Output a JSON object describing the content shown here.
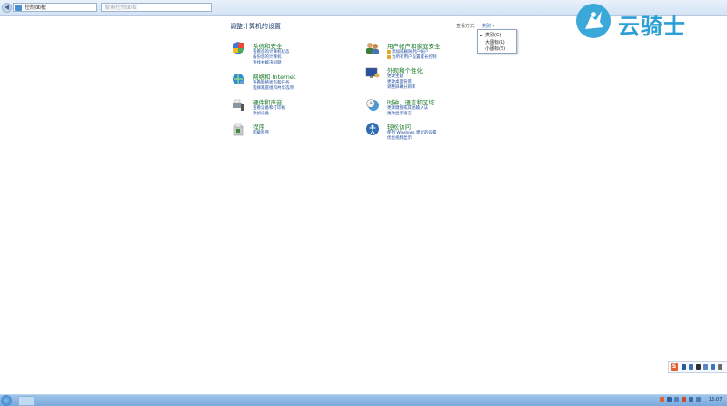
{
  "address_bar": {
    "back_label": "◀",
    "forward_label": "▶",
    "path": "控制面板",
    "search_placeholder": "搜索控制面板"
  },
  "logo": {
    "text": "云骑士"
  },
  "page": {
    "title": "调整计算机的设置",
    "view_by_label": "查看方式:",
    "view_by_value": "类别 ▾"
  },
  "view_menu": {
    "items": [
      "类别(C)",
      "大图标(L)",
      "小图标(S)"
    ],
    "selected_index": 0
  },
  "categories_left": [
    {
      "title": "系统和安全",
      "icon": "shield-flag-icon",
      "links": [
        "查看您的计算机状态",
        "备份您的计算机",
        "查找并解决问题"
      ]
    },
    {
      "title": "网络和 Internet",
      "icon": "globe-network-icon",
      "links": [
        "查看网络状态和任务",
        "选择家庭组和共享选项"
      ]
    },
    {
      "title": "硬件和声音",
      "icon": "printer-speaker-icon",
      "links": [
        "查看设备和打印机",
        "添加设备"
      ]
    },
    {
      "title": "程序",
      "icon": "program-box-icon",
      "links": [
        "卸载程序"
      ]
    }
  ],
  "categories_right": [
    {
      "title": "用户帐户和家庭安全",
      "icon": "users-icon",
      "links": [
        "添加或删除用户帐户",
        "为所有用户设置家长控制"
      ]
    },
    {
      "title": "外观和个性化",
      "icon": "monitor-paint-icon",
      "links": [
        "更改主题",
        "更改桌面背景",
        "调整屏幕分辨率"
      ]
    },
    {
      "title": "时钟、语言和区域",
      "icon": "clock-globe-icon",
      "links": [
        "更改键盘或其他输入法",
        "更改显示语言"
      ]
    },
    {
      "title": "轻松访问",
      "icon": "ease-of-access-icon",
      "links": [
        "使用 Windows 建议的设置",
        "优化视频显示"
      ]
    }
  ],
  "ime_toolbar": {
    "label": "S"
  },
  "taskbar": {
    "time": "15:07"
  },
  "colors": {
    "category_title": "#1b7a28",
    "link": "#1f4fa0",
    "page_title": "#1e3f6e",
    "logo": "#2c9fd4"
  }
}
